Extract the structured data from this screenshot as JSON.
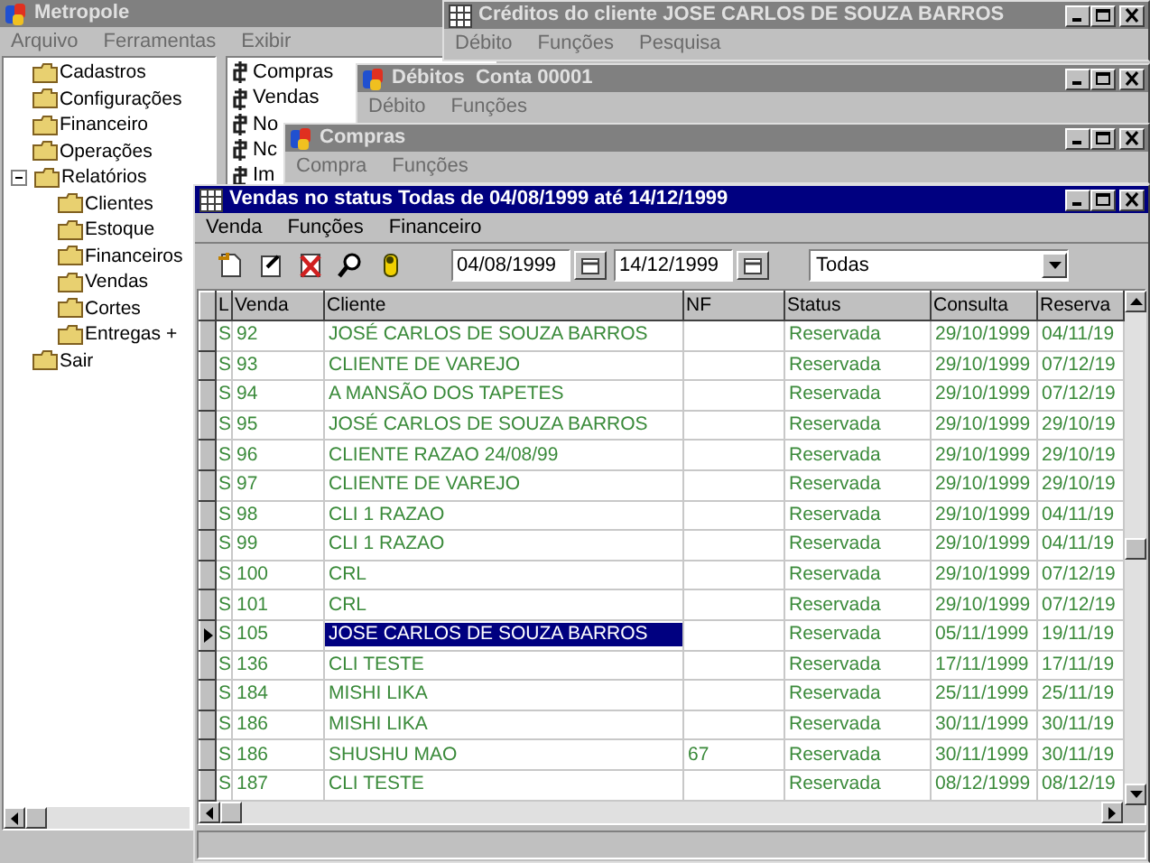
{
  "windows": [
    {
      "title": "Metropole",
      "active": false,
      "menu": [
        "Arquivo",
        "Ferramentas",
        "Exibir"
      ],
      "tree": [
        {
          "label": "Cadastros"
        },
        {
          "label": "Configurações"
        },
        {
          "label": "Financeiro"
        },
        {
          "label": "Operações"
        },
        {
          "label": "Relatórios",
          "expanded": true,
          "children": [
            {
              "label": "Clientes"
            },
            {
              "label": "Estoque"
            },
            {
              "label": "Financeiros"
            },
            {
              "label": "Vendas"
            },
            {
              "label": "Cortes"
            },
            {
              "label": "Entregas +"
            }
          ]
        },
        {
          "label": "Sair"
        }
      ],
      "shortcuts": [
        "Compras",
        "Vendas",
        "No",
        "Nc",
        "Im"
      ]
    },
    {
      "title": "Créditos do cliente JOSE CARLOS DE SOUZA BARROS",
      "active": false,
      "menu": [
        "Débito",
        "Funções",
        "Pesquisa"
      ]
    },
    {
      "title": "Débitos  Conta 00001",
      "active": false,
      "menu": [
        "Débito",
        "Funções"
      ]
    },
    {
      "title": "Compras",
      "active": false,
      "menu": [
        "Compra",
        "Funções"
      ]
    },
    {
      "title": "Vendas no status Todas de 04/08/1999 até 14/12/1999",
      "active": true,
      "menu": [
        "Venda",
        "Funções",
        "Financeiro"
      ],
      "toolbar": {
        "date_from": "04/08/1999",
        "date_to": "14/12/1999",
        "status_filter": "Todas"
      },
      "table": {
        "columns": [
          "L",
          "Venda",
          "Cliente",
          "NF",
          "Status",
          "Consulta",
          "Reserva"
        ],
        "rows": [
          {
            "l": "S",
            "venda": "92",
            "cliente": "JOSÉ CARLOS DE SOUZA BARROS",
            "nf": "",
            "status": "Reservada",
            "consulta": "29/10/1999",
            "reserva": "04/11/19",
            "selected": false
          },
          {
            "l": "S",
            "venda": "93",
            "cliente": "CLIENTE DE VAREJO",
            "nf": "",
            "status": "Reservada",
            "consulta": "29/10/1999",
            "reserva": "07/12/19",
            "selected": false
          },
          {
            "l": "S",
            "venda": "94",
            "cliente": "A MANSÃO DOS TAPETES",
            "nf": "",
            "status": "Reservada",
            "consulta": "29/10/1999",
            "reserva": "07/12/19",
            "selected": false
          },
          {
            "l": "S",
            "venda": "95",
            "cliente": "JOSÉ CARLOS DE SOUZA BARROS",
            "nf": "",
            "status": "Reservada",
            "consulta": "29/10/1999",
            "reserva": "29/10/19",
            "selected": false
          },
          {
            "l": "S",
            "venda": "96",
            "cliente": "CLIENTE RAZAO 24/08/99",
            "nf": "",
            "status": "Reservada",
            "consulta": "29/10/1999",
            "reserva": "29/10/19",
            "selected": false
          },
          {
            "l": "S",
            "venda": "97",
            "cliente": "CLIENTE DE VAREJO",
            "nf": "",
            "status": "Reservada",
            "consulta": "29/10/1999",
            "reserva": "29/10/19",
            "selected": false
          },
          {
            "l": "S",
            "venda": "98",
            "cliente": "CLI 1 RAZAO",
            "nf": "",
            "status": "Reservada",
            "consulta": "29/10/1999",
            "reserva": "04/11/19",
            "selected": false
          },
          {
            "l": "S",
            "venda": "99",
            "cliente": "CLI 1 RAZAO",
            "nf": "",
            "status": "Reservada",
            "consulta": "29/10/1999",
            "reserva": "04/11/19",
            "selected": false
          },
          {
            "l": "S",
            "venda": "100",
            "cliente": "CRL",
            "nf": "",
            "status": "Reservada",
            "consulta": "29/10/1999",
            "reserva": "07/12/19",
            "selected": false
          },
          {
            "l": "S",
            "venda": "101",
            "cliente": "CRL",
            "nf": "",
            "status": "Reservada",
            "consulta": "29/10/1999",
            "reserva": "07/12/19",
            "selected": false
          },
          {
            "l": "S",
            "venda": "105",
            "cliente": "JOSE CARLOS DE SOUZA BARROS",
            "nf": "",
            "status": "Reservada",
            "consulta": "05/11/1999",
            "reserva": "19/11/19",
            "selected": true
          },
          {
            "l": "S",
            "venda": "136",
            "cliente": "CLI TESTE",
            "nf": "",
            "status": "Reservada",
            "consulta": "17/11/1999",
            "reserva": "17/11/19",
            "selected": false
          },
          {
            "l": "S",
            "venda": "184",
            "cliente": "MISHI LIKA",
            "nf": "",
            "status": "Reservada",
            "consulta": "25/11/1999",
            "reserva": "25/11/19",
            "selected": false
          },
          {
            "l": "S",
            "venda": "186",
            "cliente": "MISHI LIKA",
            "nf": "",
            "status": "Reservada",
            "consulta": "30/11/1999",
            "reserva": "30/11/19",
            "selected": false
          },
          {
            "l": "S",
            "venda": "186",
            "cliente": "SHUSHU MAO",
            "nf": "67",
            "status": "Reservada",
            "consulta": "30/11/1999",
            "reserva": "30/11/19",
            "selected": false
          },
          {
            "l": "S",
            "venda": "187",
            "cliente": "CLI TESTE",
            "nf": "",
            "status": "Reservada",
            "consulta": "08/12/1999",
            "reserva": "08/12/19",
            "selected": false
          }
        ]
      }
    }
  ]
}
